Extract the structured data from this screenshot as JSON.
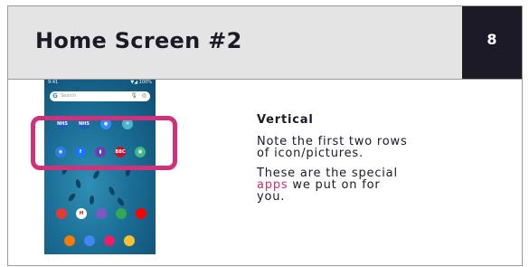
{
  "header": {
    "title": "Home Screen #2",
    "page_number": "8"
  },
  "phone": {
    "status_left": "9:41",
    "status_right": "▼◢ 100%",
    "search_placeholder": "Search",
    "search_logo": "G",
    "row1": [
      {
        "icon": "nhs-icon",
        "text": "NHS",
        "color": "#1d5fb5"
      },
      {
        "icon": "nhs-app-icon",
        "text": "NHS",
        "color": "#1d5fb5"
      },
      {
        "icon": "zoom-icon",
        "text": "●",
        "color": "#2d8cff"
      },
      {
        "icon": "fitbit-icon",
        "text": "✳",
        "color": "#4ab7c9"
      }
    ],
    "row2": [
      {
        "icon": "camera-icon",
        "text": "◉",
        "color": "#2a7de1"
      },
      {
        "icon": "facebook-icon",
        "text": "f",
        "color": "#1877f2"
      },
      {
        "icon": "smartview-icon",
        "text": "▮",
        "color": "#6a3fb0"
      },
      {
        "icon": "bbc-icon",
        "text": "BBC",
        "color": "#c8102e"
      },
      {
        "icon": "game-icon",
        "text": "▣",
        "color": "#41b883"
      }
    ],
    "row3": [
      {
        "icon": "contacts-icon",
        "color": "#e53935"
      },
      {
        "icon": "gmail-icon",
        "color": "#ffffff"
      },
      {
        "icon": "gallery-icon",
        "color": "#7e57c2"
      },
      {
        "icon": "play-store-icon",
        "color": "#34a853"
      },
      {
        "icon": "youtube-icon",
        "color": "#ff0000"
      }
    ],
    "dock": [
      {
        "icon": "phone-icon",
        "color": "#f57c00"
      },
      {
        "icon": "chrome-icon",
        "color": "#4285f4"
      },
      {
        "icon": "camera-app-icon",
        "color": "#e91e63"
      },
      {
        "icon": "messages-icon",
        "color": "#fbc02d"
      }
    ]
  },
  "content": {
    "heading": "Vertical",
    "para1_line1": "Note the first two rows",
    "para1_line2": "of icon/pictures.",
    "para2_line1": "These are the special",
    "para2_highlight": "apps",
    "para2_rest": " we put on for",
    "para2_line3": "you."
  },
  "colors": {
    "accent": "#c7326f",
    "highlight_border": "#d1307a",
    "header_bg": "#e4e4e4",
    "page_box": "#1c1a26"
  }
}
